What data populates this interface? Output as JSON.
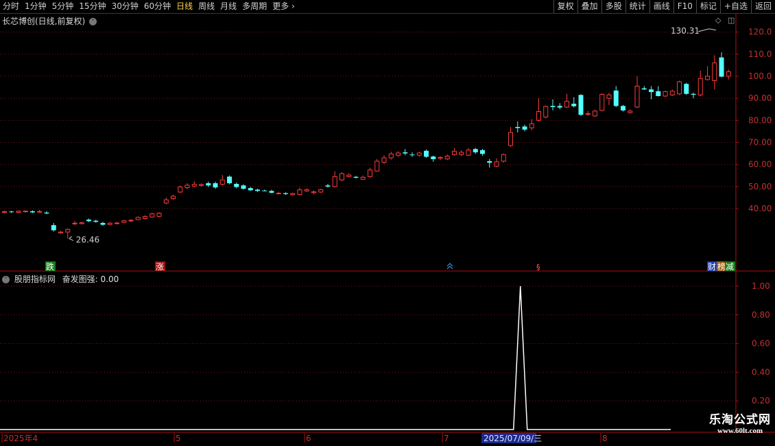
{
  "toolbar": {
    "periods": [
      "分时",
      "1分钟",
      "5分钟",
      "15分钟",
      "30分钟",
      "60分钟",
      "日线",
      "周线",
      "月线",
      "多周期"
    ],
    "active_period": "日线",
    "more_label": "更多",
    "more_chevron": "›",
    "right_buttons": [
      "复权",
      "叠加",
      "多股",
      "统计",
      "画线",
      "F10",
      "标记",
      "+自选",
      "返回"
    ]
  },
  "main_chart": {
    "title": "长芯博创(日线,前复权)",
    "chevron_glyph": "˅",
    "high_label": "130.31",
    "low_label": "26.46",
    "y_ticks": [
      "120.0",
      "110.0",
      "100.0",
      "90.00",
      "80.00",
      "70.00",
      "60.00",
      "50.00",
      "40.00"
    ],
    "markers": {
      "die": "跌",
      "zhang": "涨",
      "cai": "财",
      "bang": "榜",
      "jian": "减"
    }
  },
  "sub_chart": {
    "indicator_source": "股朋指标网",
    "indicator_name": "奋发图强",
    "indicator_value": "0.00",
    "y_ticks": [
      "1.00",
      "0.80",
      "0.60",
      "0.40",
      "0.20"
    ]
  },
  "date_axis": {
    "labels": [
      "2025年4",
      "5",
      "6",
      "7",
      "8"
    ],
    "cursor_date": "2025/07/09/三"
  },
  "watermark": {
    "line1": "乐淘公式网",
    "line2": "www.60lt.com"
  },
  "colors": {
    "up": "#ff3b3b",
    "down": "#54ffff",
    "axis": "#b01010",
    "grid": "#7a1a1a",
    "text": "#c8c8c8"
  },
  "chart_data": {
    "type": "candlestick",
    "x_period": "daily",
    "ylim": [
      25,
      130.31
    ],
    "candles": [
      {
        "o": 38.5,
        "c": 38.6,
        "h": 39.0,
        "l": 38.0
      },
      {
        "o": 38.7,
        "c": 38.4,
        "h": 39.0,
        "l": 38.0
      },
      {
        "o": 38.3,
        "c": 38.8,
        "h": 39.2,
        "l": 38.0
      },
      {
        "o": 38.6,
        "c": 38.9,
        "h": 39.1,
        "l": 38.2
      },
      {
        "o": 38.8,
        "c": 38.3,
        "h": 39.2,
        "l": 38.0
      },
      {
        "o": 38.5,
        "c": 38.7,
        "h": 39.5,
        "l": 38.1
      },
      {
        "o": 38.2,
        "c": 37.8,
        "h": 38.9,
        "l": 37.5
      },
      {
        "o": 32.5,
        "c": 30.2,
        "h": 33.5,
        "l": 29.6
      },
      {
        "o": 29.0,
        "c": 29.4,
        "h": 30.0,
        "l": 28.6
      },
      {
        "o": 29.4,
        "c": 30.6,
        "h": 31.0,
        "l": 26.46
      },
      {
        "o": 33.1,
        "c": 33.4,
        "h": 34.4,
        "l": 32.6
      },
      {
        "o": 33.2,
        "c": 33.6,
        "h": 34.0,
        "l": 32.8
      },
      {
        "o": 35.0,
        "c": 34.3,
        "h": 35.5,
        "l": 33.9
      },
      {
        "o": 34.5,
        "c": 34.0,
        "h": 35.0,
        "l": 33.6
      },
      {
        "o": 33.5,
        "c": 32.7,
        "h": 34.0,
        "l": 32.2
      },
      {
        "o": 32.8,
        "c": 33.4,
        "h": 33.9,
        "l": 32.4
      },
      {
        "o": 33.2,
        "c": 33.5,
        "h": 33.9,
        "l": 32.9
      },
      {
        "o": 33.8,
        "c": 34.5,
        "h": 34.9,
        "l": 33.4
      },
      {
        "o": 34.4,
        "c": 34.7,
        "h": 35.3,
        "l": 34.0
      },
      {
        "o": 35.0,
        "c": 36.0,
        "h": 36.5,
        "l": 34.8
      },
      {
        "o": 35.5,
        "c": 36.4,
        "h": 37.0,
        "l": 35.0
      },
      {
        "o": 36.2,
        "c": 37.6,
        "h": 38.2,
        "l": 35.8
      },
      {
        "o": 36.5,
        "c": 37.9,
        "h": 38.4,
        "l": 36.0
      },
      {
        "o": 42.5,
        "c": 44.0,
        "h": 45.0,
        "l": 42.0
      },
      {
        "o": 44.5,
        "c": 45.6,
        "h": 46.3,
        "l": 44.0
      },
      {
        "o": 47.5,
        "c": 49.8,
        "h": 50.5,
        "l": 47.0
      },
      {
        "o": 49.5,
        "c": 50.6,
        "h": 51.5,
        "l": 48.8
      },
      {
        "o": 50.2,
        "c": 51.0,
        "h": 52.5,
        "l": 49.8
      },
      {
        "o": 50.5,
        "c": 50.9,
        "h": 51.4,
        "l": 50.0
      },
      {
        "o": 51.5,
        "c": 50.5,
        "h": 52.3,
        "l": 49.8
      },
      {
        "o": 51.5,
        "c": 49.6,
        "h": 52.2,
        "l": 49.0
      },
      {
        "o": 51.0,
        "c": 53.0,
        "h": 55.2,
        "l": 50.5
      },
      {
        "o": 54.5,
        "c": 51.5,
        "h": 55.0,
        "l": 51.0
      },
      {
        "o": 51.2,
        "c": 49.8,
        "h": 51.8,
        "l": 49.2
      },
      {
        "o": 50.5,
        "c": 49.0,
        "h": 51.0,
        "l": 48.6
      },
      {
        "o": 49.3,
        "c": 48.3,
        "h": 49.8,
        "l": 48.0
      },
      {
        "o": 48.6,
        "c": 48.0,
        "h": 49.0,
        "l": 47.6
      },
      {
        "o": 48.2,
        "c": 48.0,
        "h": 48.6,
        "l": 47.8
      },
      {
        "o": 48.0,
        "c": 47.2,
        "h": 48.5,
        "l": 46.9
      },
      {
        "o": 46.8,
        "c": 47.0,
        "h": 47.5,
        "l": 46.5
      },
      {
        "o": 47.0,
        "c": 46.6,
        "h": 47.4,
        "l": 46.2
      },
      {
        "o": 46.3,
        "c": 46.8,
        "h": 47.2,
        "l": 46.0
      },
      {
        "o": 46.4,
        "c": 48.5,
        "h": 49.5,
        "l": 46.0
      },
      {
        "o": 48.0,
        "c": 48.6,
        "h": 49.2,
        "l": 47.5
      },
      {
        "o": 47.2,
        "c": 47.6,
        "h": 48.2,
        "l": 46.5
      },
      {
        "o": 47.5,
        "c": 48.6,
        "h": 49.0,
        "l": 47.0
      },
      {
        "o": 50.5,
        "c": 50.0,
        "h": 51.2,
        "l": 49.5
      },
      {
        "o": 50.0,
        "c": 54.5,
        "h": 57.0,
        "l": 49.6
      },
      {
        "o": 53.0,
        "c": 55.8,
        "h": 56.5,
        "l": 52.5
      },
      {
        "o": 54.5,
        "c": 55.2,
        "h": 56.0,
        "l": 54.0
      },
      {
        "o": 54.4,
        "c": 54.0,
        "h": 54.8,
        "l": 53.6
      },
      {
        "o": 53.3,
        "c": 54.2,
        "h": 55.0,
        "l": 53.0
      },
      {
        "o": 54.5,
        "c": 57.5,
        "h": 58.5,
        "l": 54.0
      },
      {
        "o": 57.0,
        "c": 61.5,
        "h": 62.5,
        "l": 56.8
      },
      {
        "o": 61.0,
        "c": 63.0,
        "h": 64.2,
        "l": 60.2
      },
      {
        "o": 63.0,
        "c": 64.8,
        "h": 65.8,
        "l": 62.2
      },
      {
        "o": 64.2,
        "c": 65.2,
        "h": 66.0,
        "l": 63.5
      },
      {
        "o": 65.5,
        "c": 65.0,
        "h": 67.0,
        "l": 64.2
      },
      {
        "o": 64.5,
        "c": 64.3,
        "h": 65.5,
        "l": 63.5
      },
      {
        "o": 64.2,
        "c": 65.2,
        "h": 65.8,
        "l": 63.5
      },
      {
        "o": 66.2,
        "c": 63.5,
        "h": 66.8,
        "l": 63.0
      },
      {
        "o": 63.6,
        "c": 62.4,
        "h": 64.0,
        "l": 61.2
      },
      {
        "o": 62.8,
        "c": 63.2,
        "h": 63.8,
        "l": 62.0
      },
      {
        "o": 62.5,
        "c": 63.8,
        "h": 64.5,
        "l": 62.0
      },
      {
        "o": 64.5,
        "c": 66.0,
        "h": 67.5,
        "l": 64.0
      },
      {
        "o": 64.5,
        "c": 65.5,
        "h": 66.5,
        "l": 63.8
      },
      {
        "o": 64.2,
        "c": 66.5,
        "h": 67.5,
        "l": 63.8
      },
      {
        "o": 67.0,
        "c": 65.5,
        "h": 67.5,
        "l": 64.8
      },
      {
        "o": 66.5,
        "c": 64.8,
        "h": 67.0,
        "l": 64.0
      },
      {
        "o": 61.5,
        "c": 60.8,
        "h": 62.5,
        "l": 58.6
      },
      {
        "o": 59.2,
        "c": 61.2,
        "h": 62.8,
        "l": 58.8
      },
      {
        "o": 61.5,
        "c": 64.5,
        "h": 65.0,
        "l": 60.8
      },
      {
        "o": 68.6,
        "c": 74.5,
        "h": 77.0,
        "l": 68.0
      },
      {
        "o": 77.0,
        "c": 76.5,
        "h": 79.5,
        "l": 74.5
      },
      {
        "o": 77.2,
        "c": 75.8,
        "h": 78.0,
        "l": 75.0
      },
      {
        "o": 76.6,
        "c": 78.4,
        "h": 80.6,
        "l": 75.5
      },
      {
        "o": 80.0,
        "c": 84.0,
        "h": 90.0,
        "l": 79.5
      },
      {
        "o": 81.5,
        "c": 86.3,
        "h": 86.8,
        "l": 80.8
      },
      {
        "o": 86.5,
        "c": 86.0,
        "h": 89.5,
        "l": 84.5
      },
      {
        "o": 86.5,
        "c": 85.8,
        "h": 87.8,
        "l": 85.0
      },
      {
        "o": 86.0,
        "c": 88.6,
        "h": 92.0,
        "l": 85.5
      },
      {
        "o": 87.5,
        "c": 86.4,
        "h": 90.5,
        "l": 85.8
      },
      {
        "o": 91.5,
        "c": 82.5,
        "h": 91.8,
        "l": 82.0
      },
      {
        "o": 83.0,
        "c": 83.0,
        "h": 84.2,
        "l": 82.0
      },
      {
        "o": 82.0,
        "c": 84.2,
        "h": 84.8,
        "l": 81.5
      },
      {
        "o": 84.5,
        "c": 91.8,
        "h": 92.2,
        "l": 84.0
      },
      {
        "o": 90.0,
        "c": 91.5,
        "h": 92.5,
        "l": 87.0
      },
      {
        "o": 93.5,
        "c": 86.5,
        "h": 95.5,
        "l": 86.0
      },
      {
        "o": 86.5,
        "c": 84.5,
        "h": 87.0,
        "l": 84.0
      },
      {
        "o": 83.5,
        "c": 84.2,
        "h": 85.0,
        "l": 83.0
      },
      {
        "o": 86.0,
        "c": 95.5,
        "h": 100.0,
        "l": 85.5
      },
      {
        "o": 94.5,
        "c": 94.0,
        "h": 95.5,
        "l": 93.8
      },
      {
        "o": 94.0,
        "c": 92.8,
        "h": 95.5,
        "l": 89.5
      },
      {
        "o": 93.2,
        "c": 91.0,
        "h": 95.5,
        "l": 90.8
      },
      {
        "o": 91.0,
        "c": 93.0,
        "h": 93.5,
        "l": 90.5
      },
      {
        "o": 91.5,
        "c": 93.2,
        "h": 94.0,
        "l": 91.0
      },
      {
        "o": 92.0,
        "c": 97.5,
        "h": 98.0,
        "l": 91.5
      },
      {
        "o": 96.5,
        "c": 92.0,
        "h": 97.0,
        "l": 91.5
      },
      {
        "o": 92.0,
        "c": 91.6,
        "h": 92.5,
        "l": 90.0
      },
      {
        "o": 91.5,
        "c": 99.0,
        "h": 102.5,
        "l": 90.8
      },
      {
        "o": 98.5,
        "c": 100.0,
        "h": 104.5,
        "l": 98.0
      },
      {
        "o": 98.0,
        "c": 106.0,
        "h": 109.5,
        "l": 94.0
      },
      {
        "o": 108.5,
        "c": 99.8,
        "h": 110.8,
        "l": 99.5
      },
      {
        "o": 100.0,
        "c": 102.0,
        "h": 103.0,
        "l": 98.5
      }
    ],
    "indicator": {
      "name": "奋发图强",
      "series": [
        {
          "name": "奋发图强",
          "spike_index": 73,
          "spike_value": 1.0,
          "baseline": 0.0
        }
      ]
    }
  }
}
